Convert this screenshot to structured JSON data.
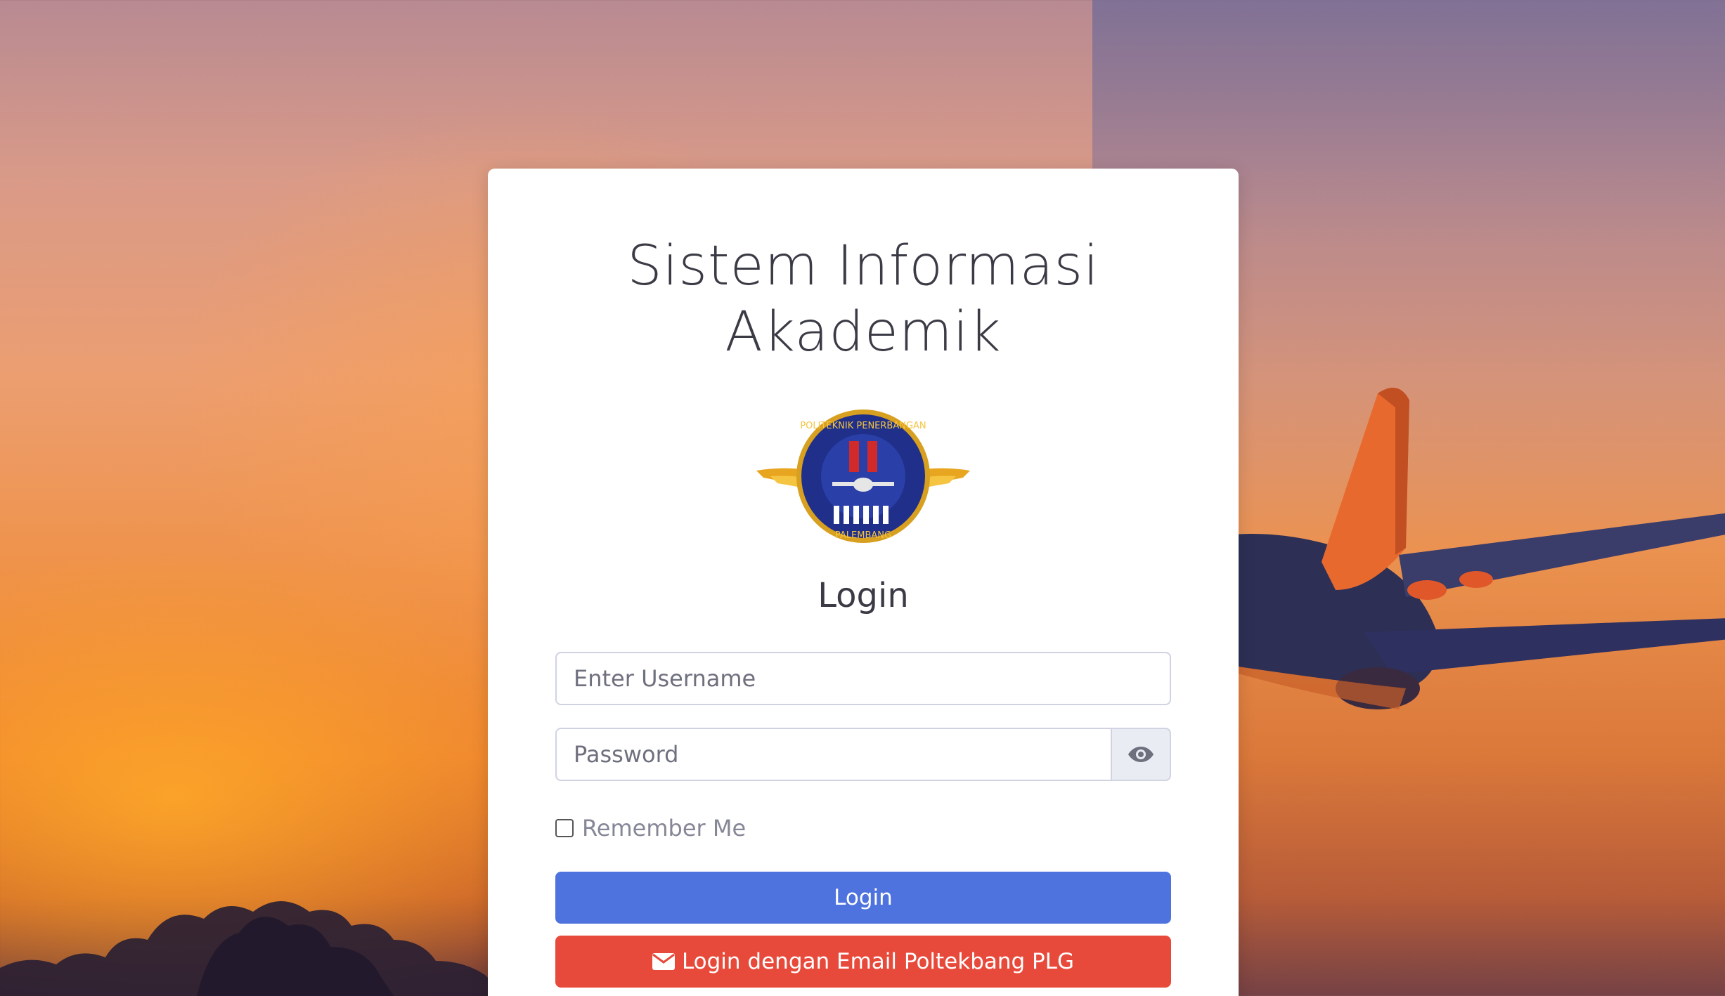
{
  "header": {
    "title_line1": "Sistem Informasi",
    "title_line2": "Akademik"
  },
  "logo": {
    "text_top": "POLITEKNIK PENERBANGAN",
    "text_bottom": "PALEMBANG"
  },
  "form": {
    "heading": "Login",
    "username_placeholder": "Enter Username",
    "password_placeholder": "Password",
    "remember_label": "Remember Me",
    "login_button": "Login",
    "email_login_button": "Login dengan Email Poltekbang PLG"
  },
  "colors": {
    "primary": "#4e73df",
    "danger": "#e74a3b",
    "text": "#3a3b45"
  },
  "icons": {
    "password_toggle": "eye-icon",
    "email_button": "envelope-icon"
  }
}
